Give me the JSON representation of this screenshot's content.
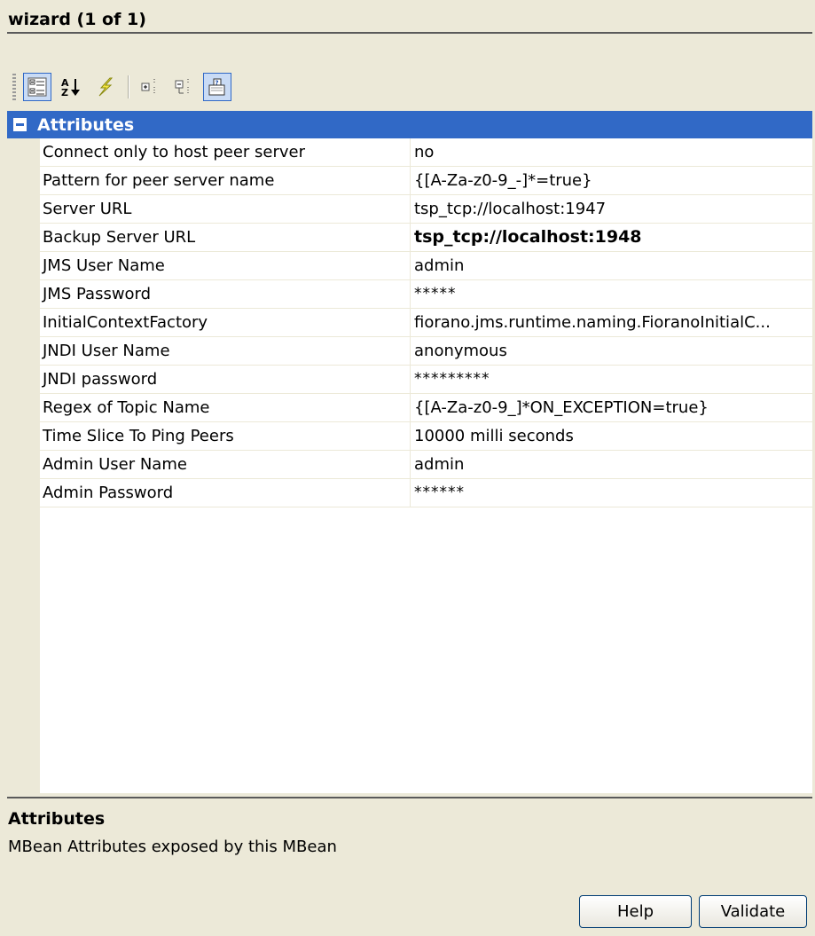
{
  "title": "wizard (1 of 1)",
  "toolbar": {
    "buttons": [
      {
        "icon": "categorized-view-icon",
        "active": true
      },
      {
        "icon": "sort-alphabetical-icon",
        "active": false
      },
      {
        "icon": "lightning-icon",
        "active": false
      },
      {
        "icon": "expand-all-icon",
        "active": false
      },
      {
        "icon": "collapse-all-icon",
        "active": false
      },
      {
        "icon": "description-toggle-icon",
        "active": true
      }
    ]
  },
  "grid": {
    "category": "Attributes",
    "rows": [
      {
        "name": "Connect only to host peer server",
        "value": "no",
        "style": "normal"
      },
      {
        "name": "Pattern for peer server name",
        "value": "{[A-Za-z0-9_-]*=true}",
        "style": "normal"
      },
      {
        "name": "Server URL",
        "value": "tsp_tcp://localhost:1947",
        "style": "normal"
      },
      {
        "name": "Backup Server URL",
        "value": "tsp_tcp://localhost:1948",
        "style": "bold"
      },
      {
        "name": "JMS User Name",
        "value": "admin",
        "style": "normal"
      },
      {
        "name": "JMS Password",
        "value": "*****",
        "style": "password"
      },
      {
        "name": "InitialContextFactory",
        "value": "fiorano.jms.runtime.naming.FioranoInitialC...",
        "style": "normal"
      },
      {
        "name": "JNDI User Name",
        "value": "anonymous",
        "style": "normal"
      },
      {
        "name": "JNDI password",
        "value": "*********",
        "style": "password"
      },
      {
        "name": "Regex of Topic Name",
        "value": "{[A-Za-z0-9_]*ON_EXCEPTION=true}",
        "style": "normal"
      },
      {
        "name": "Time Slice To Ping Peers",
        "value": "10000  milli seconds",
        "style": "normal"
      },
      {
        "name": "Admin User Name",
        "value": "admin",
        "style": "normal"
      },
      {
        "name": "Admin Password",
        "value": "******",
        "style": "password"
      }
    ]
  },
  "description": {
    "title": "Attributes",
    "text": "MBean Attributes exposed by this MBean"
  },
  "buttons": {
    "help": "Help",
    "validate": "Validate"
  }
}
